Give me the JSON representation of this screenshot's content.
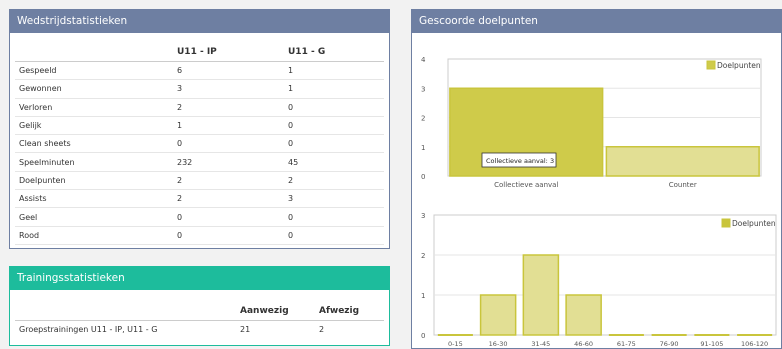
{
  "wedstrijd": {
    "title": "Wedstrijdstatistieken",
    "headers": [
      "",
      "U11 - IP",
      "U11 - G"
    ],
    "rows": [
      [
        "Gespeeld",
        "6",
        "1"
      ],
      [
        "Gewonnen",
        "3",
        "1"
      ],
      [
        "Verloren",
        "2",
        "0"
      ],
      [
        "Gelijk",
        "1",
        "0"
      ],
      [
        "Clean sheets",
        "0",
        "0"
      ],
      [
        "Speelminuten",
        "232",
        "45"
      ],
      [
        "Doelpunten",
        "2",
        "2"
      ],
      [
        "Assists",
        "2",
        "3"
      ],
      [
        "Geel",
        "0",
        "0"
      ],
      [
        "Rood",
        "0",
        "0"
      ]
    ]
  },
  "training": {
    "title": "Trainingsstatistieken",
    "headers": [
      "",
      "Aanwezig",
      "Afwezig"
    ],
    "rows": [
      [
        "Groepstrainingen U11 - IP, U11 - G",
        "21",
        "2"
      ]
    ]
  },
  "goals": {
    "title": "Gescoorde doelpunten"
  },
  "chart_data": [
    {
      "type": "bar",
      "categories": [
        "Collectieve aanval",
        "Counter"
      ],
      "series": [
        {
          "name": "Doelpunten",
          "values": [
            3,
            1
          ]
        }
      ],
      "ylim": [
        0,
        4
      ],
      "yticks": [
        "0",
        "1",
        "2",
        "3",
        "4"
      ],
      "legend": "top-right",
      "highlight_index": 0,
      "tooltip": "Collectieve aanval: 3",
      "colors": {
        "fill": "#e2df94",
        "stroke": "#c9c53c",
        "highlight": "#cfcb4a"
      }
    },
    {
      "type": "bar",
      "categories": [
        "0-15",
        "16-30",
        "31-45",
        "46-60",
        "61-75",
        "76-90",
        "91-105",
        "106-120"
      ],
      "series": [
        {
          "name": "Doelpunten",
          "values": [
            0,
            1,
            2,
            1,
            0,
            0,
            0,
            0
          ]
        }
      ],
      "ylim": [
        0,
        3
      ],
      "yticks": [
        "0",
        "1",
        "2",
        "3"
      ],
      "legend": "top-right",
      "colors": {
        "fill": "#e2df94",
        "stroke": "#c9c53c"
      }
    }
  ]
}
